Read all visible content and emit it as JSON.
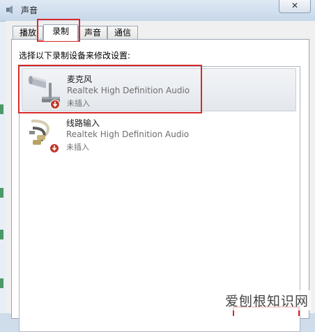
{
  "window": {
    "title": "声音",
    "close_glyph": "✕"
  },
  "tabs": [
    {
      "label": "播放"
    },
    {
      "label": "录制",
      "active": true
    },
    {
      "label": "声音"
    },
    {
      "label": "通信"
    }
  ],
  "instruction": "选择以下录制设备来修改设置:",
  "devices": [
    {
      "name": "麦克风",
      "driver": "Realtek High Definition Audio",
      "status": "未插入",
      "icon": "microphone-icon",
      "selected": true
    },
    {
      "name": "线路输入",
      "driver": "Realtek High Definition Audio",
      "status": "未插入",
      "icon": "line-in-icon",
      "selected": false
    }
  ],
  "watermark": "爱刨根知识网",
  "colors": {
    "annotation": "#d62a2a",
    "unplugged_badge": "#c0392b"
  }
}
